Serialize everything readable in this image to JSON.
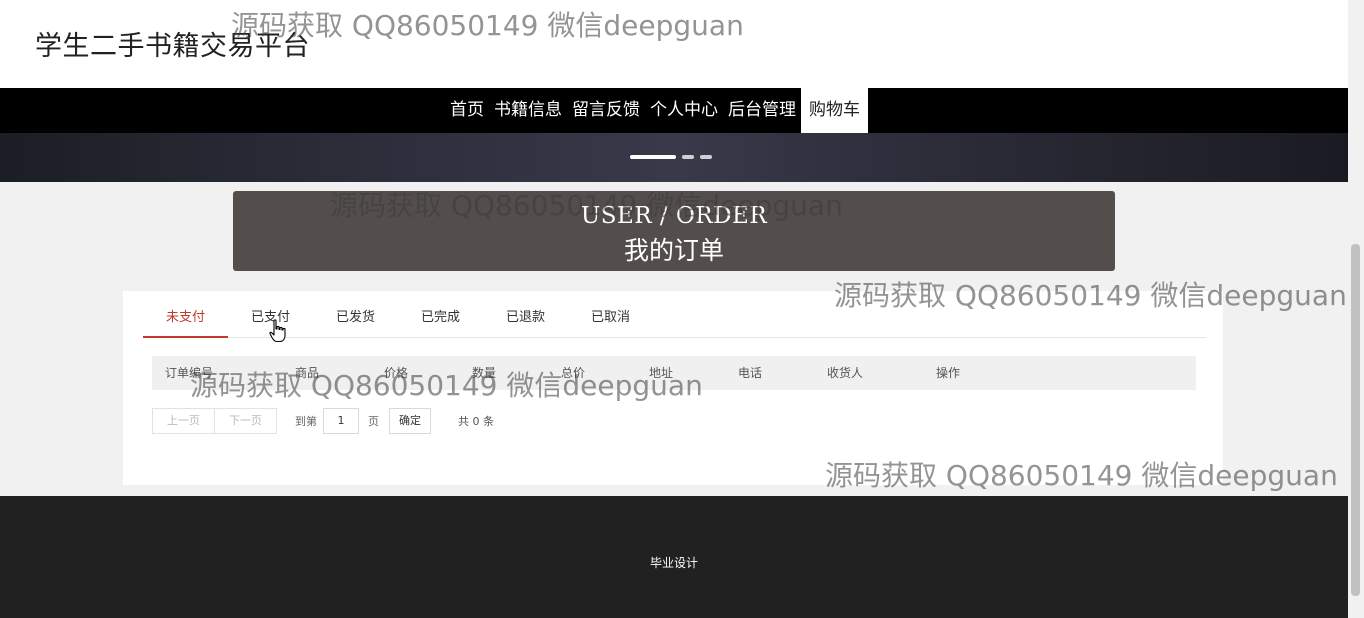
{
  "header": {
    "site_title": "学生二手书籍交易平台"
  },
  "nav": {
    "items": [
      {
        "label": "首页",
        "active": false
      },
      {
        "label": "书籍信息",
        "active": false
      },
      {
        "label": "留言反馈",
        "active": false
      },
      {
        "label": "个人中心",
        "active": false
      },
      {
        "label": "后台管理",
        "active": false
      },
      {
        "label": "购物车",
        "active": true
      }
    ]
  },
  "banner": {
    "slide_count": 3,
    "active_slide": 1
  },
  "section_title": {
    "en": "USER / ORDER",
    "cn": "我的订单"
  },
  "order_tabs": [
    {
      "label": "未支付",
      "active": true
    },
    {
      "label": "已支付",
      "active": false
    },
    {
      "label": "已发货",
      "active": false
    },
    {
      "label": "已完成",
      "active": false
    },
    {
      "label": "已退款",
      "active": false
    },
    {
      "label": "已取消",
      "active": false
    }
  ],
  "table": {
    "columns": [
      "订单编号",
      "商品",
      "价格",
      "数量",
      "总价",
      "地址",
      "电话",
      "收货人",
      "操作"
    ],
    "rows": []
  },
  "pagination": {
    "prev_label": "上一页",
    "next_label": "下一页",
    "goto_label": "到第",
    "page_value": "1",
    "page_suffix": "页",
    "confirm_label": "确定",
    "total_label": "共 0 条"
  },
  "footer": {
    "text": "毕业设计"
  },
  "watermark": {
    "text": "源码获取 QQ86050149 微信deepguan"
  },
  "colors": {
    "accent": "#c0392b",
    "nav_bg": "#000000",
    "footer_bg": "#212121",
    "title_box_bg": "#534e4c"
  }
}
